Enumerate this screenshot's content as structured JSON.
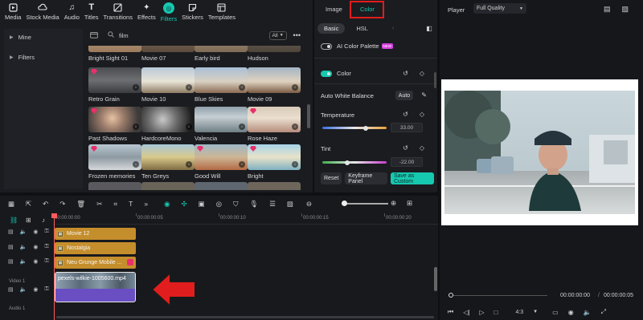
{
  "toolbar": {
    "tabs": [
      {
        "label": "Media",
        "icon": "media-icon"
      },
      {
        "label": "Stock Media",
        "icon": "cloud-icon"
      },
      {
        "label": "Audio",
        "icon": "music-icon"
      },
      {
        "label": "Titles",
        "icon": "titles-icon"
      },
      {
        "label": "Transitions",
        "icon": "transitions-icon"
      },
      {
        "label": "Effects",
        "icon": "effects-icon"
      },
      {
        "label": "Filters",
        "icon": "filters-icon"
      },
      {
        "label": "Stickers",
        "icon": "stickers-icon"
      },
      {
        "label": "Templates",
        "icon": "templates-icon"
      }
    ],
    "active": "Filters"
  },
  "sidebar": {
    "items": [
      {
        "label": "Mine"
      },
      {
        "label": "Filters"
      }
    ]
  },
  "search": {
    "value": "film",
    "all_label": "All"
  },
  "filters": [
    {
      "label": "Bright Sight 01"
    },
    {
      "label": "Movie 07"
    },
    {
      "label": "Early bird"
    },
    {
      "label": "Hudson"
    },
    {
      "label": "Retro Grain"
    },
    {
      "label": "Movie 10"
    },
    {
      "label": "Blue Skies"
    },
    {
      "label": "Movie 09"
    },
    {
      "label": "Past Shadows"
    },
    {
      "label": "HardcoreMono"
    },
    {
      "label": "Valencia"
    },
    {
      "label": "Rose Haze"
    },
    {
      "label": "Frozen memories"
    },
    {
      "label": "Ten Greys"
    },
    {
      "label": "Good Will"
    },
    {
      "label": "Bright"
    }
  ],
  "color_panel": {
    "tabs": {
      "image": "Image",
      "color": "Color"
    },
    "subtabs": {
      "basic": "Basic",
      "hsl": "HSL"
    },
    "ai_palette": {
      "label": "AI Color Palette",
      "badge": "NEW"
    },
    "color_label": "Color",
    "awb": {
      "label": "Auto White Balance",
      "button": "Auto"
    },
    "temperature": {
      "label": "Temperature",
      "value": "33.00",
      "level": 0.67
    },
    "tint": {
      "label": "Tint",
      "value": "-22.00",
      "level": 0.39
    },
    "buttons": {
      "reset": "Reset",
      "keyframe": "Keyframe Panel",
      "save": "Save as Custom"
    }
  },
  "player": {
    "title": "Player",
    "quality": "Full Quality",
    "current_time": "00:00:00:00",
    "total_time": "00:00:00:05",
    "ratio": "4:3"
  },
  "timeline": {
    "ticks": [
      "00:00:00:00",
      "00:00:00:05",
      "00:00:00:10",
      "00:00:00:15",
      "00:00:00:20"
    ],
    "clips": [
      {
        "label": "Movie 12"
      },
      {
        "label": "Nostalgia"
      },
      {
        "label": "Neu Grunge Mobile ..."
      }
    ],
    "video_clip": {
      "label": "pexels-wilkie-1005600.mp4"
    },
    "track_labels": {
      "video": "Video 1",
      "audio": "Audio 1"
    }
  },
  "colors": {
    "accent": "#17c8b0",
    "highlight_box": "#e11d1d",
    "clip_gold": "#c58e2c",
    "clip_purple": "#6a4fc3"
  }
}
